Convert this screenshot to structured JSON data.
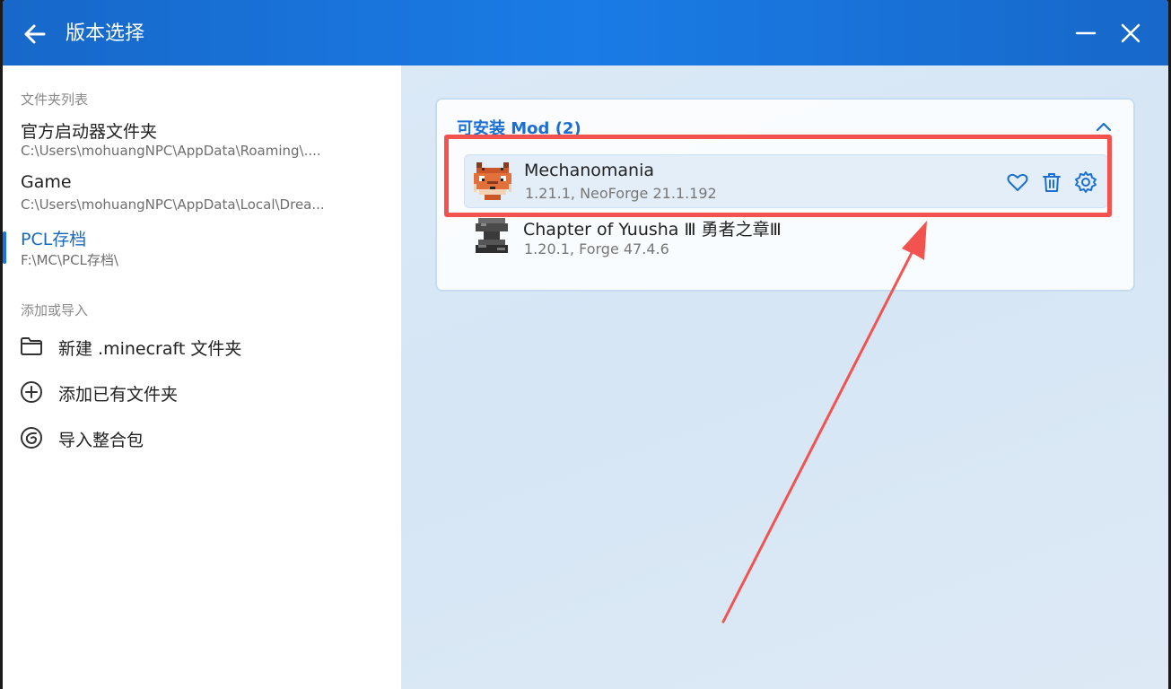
{
  "window": {
    "title": "版本选择"
  },
  "sidebar": {
    "folder_section_label": "文件夹列表",
    "folders": [
      {
        "name": "官方启动器文件夹",
        "path": "C:\\Users\\mohuangNPC\\AppData\\Roaming\\...."
      },
      {
        "name": "Game",
        "path": "C:\\Users\\mohuangNPC\\AppData\\Local\\Drea..."
      },
      {
        "name": "PCL存档",
        "path": "F:\\MC\\PCL存档\\"
      }
    ],
    "action_section_label": "添加或导入",
    "actions": [
      {
        "label": "新建 .minecraft 文件夹",
        "icon": "folder-icon"
      },
      {
        "label": "添加已有文件夹",
        "icon": "plus-circle-icon"
      },
      {
        "label": "导入整合包",
        "icon": "import-modpack-icon"
      }
    ]
  },
  "main": {
    "card_title": "可安装 Mod (2)",
    "mods": [
      {
        "name": "Mechanomania",
        "version": "1.21.1, NeoForge 21.1.192",
        "icon": "fox-mod-icon"
      },
      {
        "name": "Chapter of Yuusha Ⅲ 勇者之章Ⅲ",
        "version": "1.20.1, Forge 47.4.6",
        "icon": "anvil-mod-icon"
      }
    ]
  },
  "colors": {
    "accent": "#1a6fd0",
    "titlebar": "#1a73e8",
    "annotation": "#f2534f"
  }
}
